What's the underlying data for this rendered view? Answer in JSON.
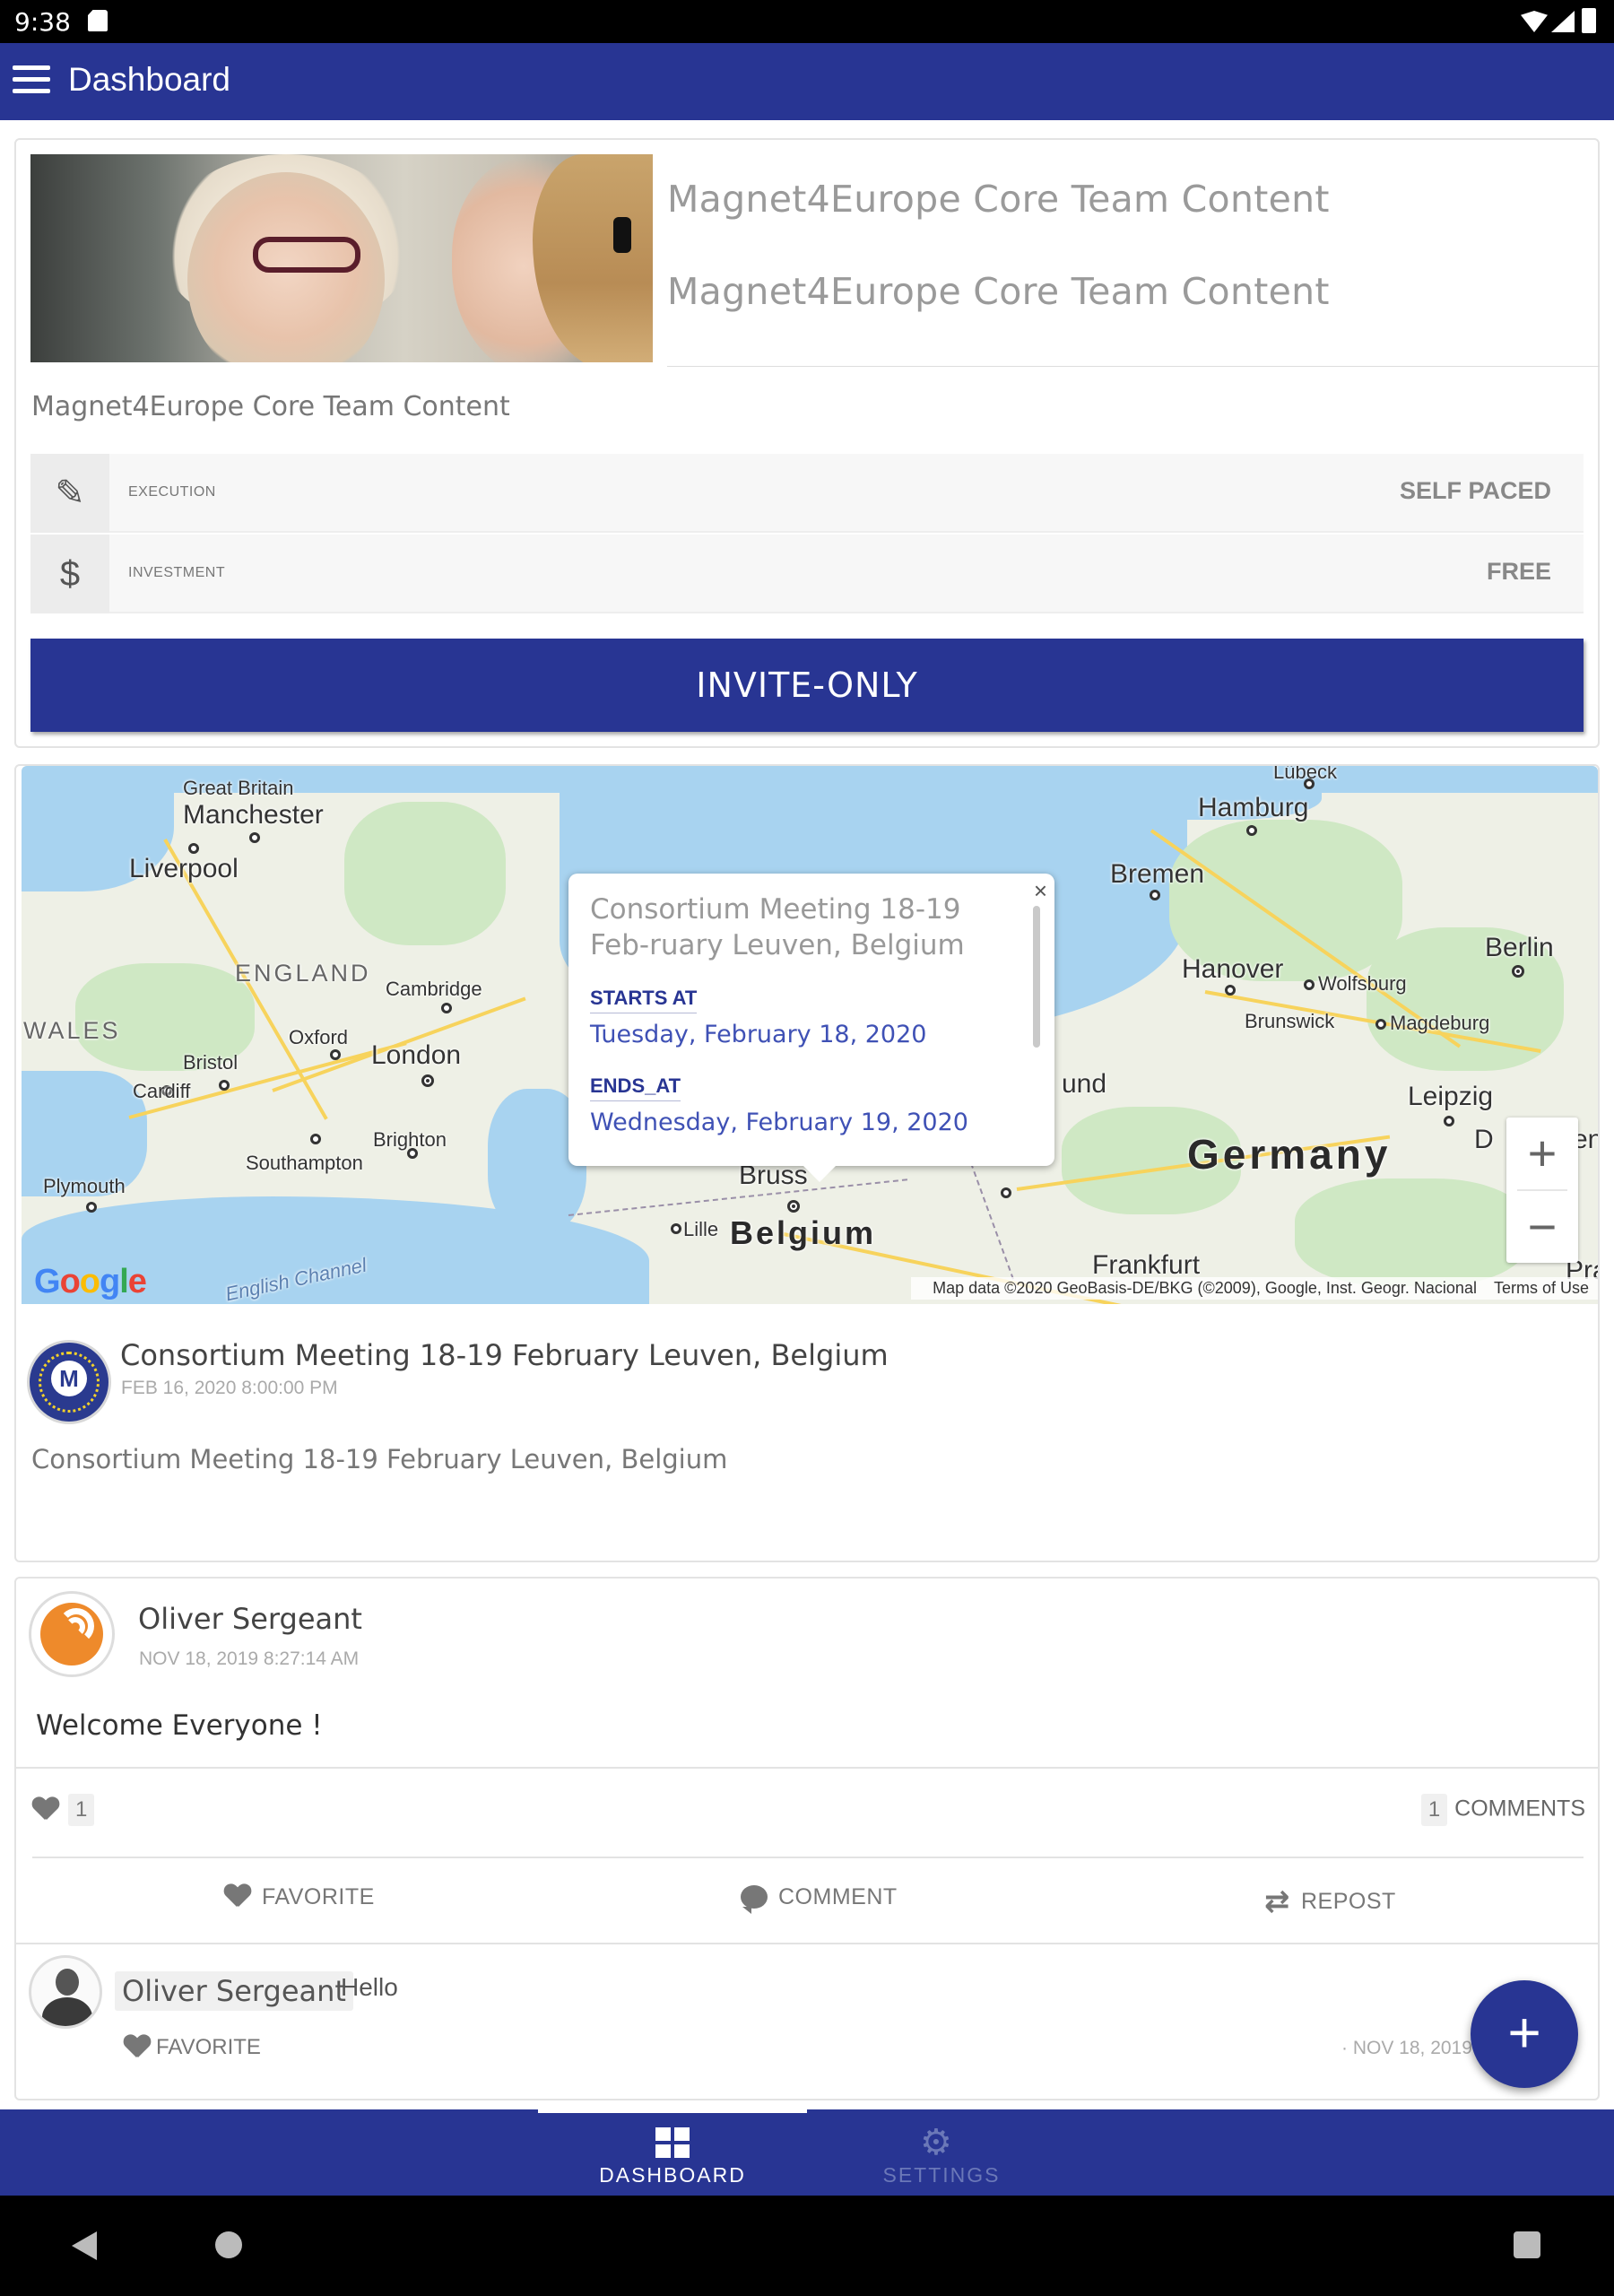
{
  "status_bar": {
    "time": "9:38"
  },
  "app_bar": {
    "title": "Dashboard",
    "menu_icon": "hamburger-menu-icon"
  },
  "course": {
    "title_line1": "Magnet4Europe Core Team Content",
    "title_line2": "Magnet4Europe Core Team Content",
    "description": "Magnet4Europe Core Team Content",
    "execution_label": "EXECUTION",
    "execution_value": "SELF PACED",
    "investment_label": "INVESTMENT",
    "investment_value": "FREE",
    "invite_button": "INVITE-ONLY"
  },
  "map": {
    "labels": {
      "great_britain": "Great Britain",
      "manchester": "Manchester",
      "liverpool": "Liverpool",
      "england": "ENGLAND",
      "wales": "WALES",
      "cambridge": "Cambridge",
      "oxford": "Oxford",
      "london": "London",
      "bristol": "Bristol",
      "cardiff": "Cardiff",
      "brighton": "Brighton",
      "southampton": "Southampton",
      "plymouth": "Plymouth",
      "english_channel": "English Channel",
      "lubeck": "Lübeck",
      "hamburg": "Hamburg",
      "bremen": "Bremen",
      "berlin": "Berlin",
      "hanover": "Hanover",
      "wolfsburg": "Wolfsburg",
      "brunswick": "Brunswick",
      "magdeburg": "Magdeburg",
      "leipzig": "Leipzig",
      "germany": "Germany",
      "frankfurt": "Frankfurt",
      "belgium": "Belgium",
      "lille": "Lille",
      "brussels_partial": "Bruss",
      "und_partial": "und",
      "d_partial": "D",
      "en_partial": "en",
      "pra_partial": "Pra"
    },
    "popup": {
      "title": "Consortium Meeting 18-19 Feb-ruary Leuven, Belgium",
      "starts_label": "STARTS AT",
      "starts_value": "Tuesday, February 18, 2020",
      "ends_label": "ENDS_AT",
      "ends_value": "Wednesday, February 19, 2020",
      "close": "×"
    },
    "zoom_in": "+",
    "zoom_out": "−",
    "google_logo": {
      "g": "G",
      "o1": "o",
      "o2": "o",
      "g2": "g",
      "l": "l",
      "e": "e"
    },
    "attribution": "Map data ©2020 GeoBasis-DE/BKG (©2009), Google, Inst. Geogr. Nacional",
    "terms": "Terms of Use"
  },
  "event": {
    "title": "Consortium Meeting 18-19 February Leuven, Belgium",
    "date": "FEB 16, 2020 8:00:00 PM",
    "description": "Consortium Meeting 18-19 February Leuven, Belgium",
    "avatar_letter": "M"
  },
  "post": {
    "author": "Oliver Sergeant",
    "date": "NOV 18, 2019 8:27:14 AM",
    "body": "Welcome Everyone !",
    "like_count": "1",
    "comment_count": "1",
    "comments_label": "COMMENTS",
    "actions": {
      "favorite": "FAVORITE",
      "comment": "COMMENT",
      "repost": "REPOST"
    }
  },
  "reply": {
    "author": "Oliver Sergeant",
    "text": "Hello",
    "favorite": "FAVORITE",
    "date": "· NOV 18, 2019"
  },
  "fab": {
    "label": "+"
  },
  "bottom_nav": {
    "items": [
      {
        "label": "DASHBOARD",
        "active": true
      },
      {
        "label": "SETTINGS",
        "active": false
      }
    ]
  },
  "colors": {
    "primary": "#283593",
    "accent_text": "#3f51b5"
  }
}
